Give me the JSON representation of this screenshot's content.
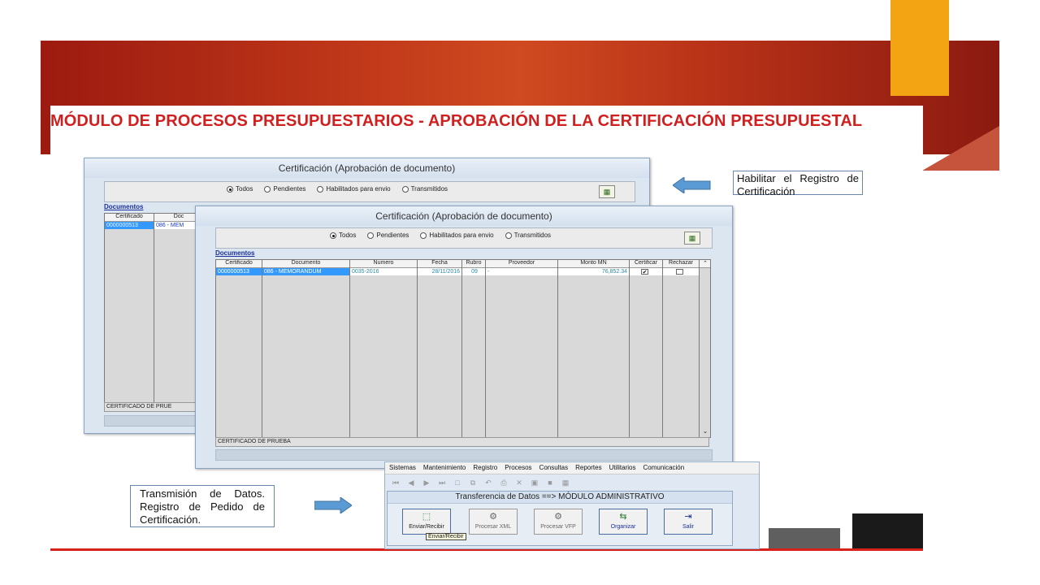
{
  "slide": {
    "title": "MÓDULO DE PROCESOS PRESUPUESTARIOS - APROBACIÓN DE LA CERTIFICACIÓN PRESUPUESTAL"
  },
  "callouts": {
    "right": "Habilitar el Registro de Certificación",
    "left": "Transmisión de Datos. Registro de Pedido de Certificación."
  },
  "back_window": {
    "title": "Certificación (Aprobación de documento)",
    "filters": [
      "Todos",
      "Pendientes",
      "Habilitados para envio",
      "Transmitidos"
    ],
    "selected_filter": "Todos",
    "docs_label": "Documentos",
    "columns": [
      "Certificado",
      "Doc"
    ],
    "row": {
      "certificado": "0000000513",
      "documento": "086 - MEM"
    },
    "status": "CERTIFICADO DE PRUE"
  },
  "front_window": {
    "title": "Certificación (Aprobación de documento)",
    "filters": [
      "Todos",
      "Pendientes",
      "Habilitados para envio",
      "Transmitidos"
    ],
    "selected_filter": "Todos",
    "docs_label": "Documentos",
    "columns": [
      "Certificado",
      "Documento",
      "Numero",
      "Fecha",
      "Rubro",
      "Proveedor",
      "Monto MN",
      "Certificar",
      "Rechazar"
    ],
    "row": {
      "certificado": "0000000513",
      "documento": "086 - MEMORANDUM",
      "numero": "0035-2016",
      "fecha": "28/11/2016",
      "rubro": "09",
      "proveedor": "-",
      "monto": "76,852.34",
      "certificar": "✔",
      "rechazar": ""
    },
    "status": "CERTIFICADO DE PRUEBA"
  },
  "erp": {
    "menu": [
      "Sistemas",
      "Mantenimiento",
      "Registro",
      "Procesos",
      "Consultas",
      "Reportes",
      "Utilitarios",
      "Comunicación"
    ],
    "panel_title": "Transferencia de Datos ==> MÓDULO ADMINISTRATIVO",
    "buttons": [
      "Enviar/Recibir",
      "Procesar XML",
      "Procesar VFP",
      "Organizar",
      "Salir"
    ],
    "tooltip": "Enviar/Recibir"
  },
  "colors": {
    "banner": "#c23a1a",
    "accent_orange": "#f2a413",
    "title_red": "#d01f1f",
    "selected_row": "#3399ff",
    "callout_arrow": "#5b9bd5"
  }
}
